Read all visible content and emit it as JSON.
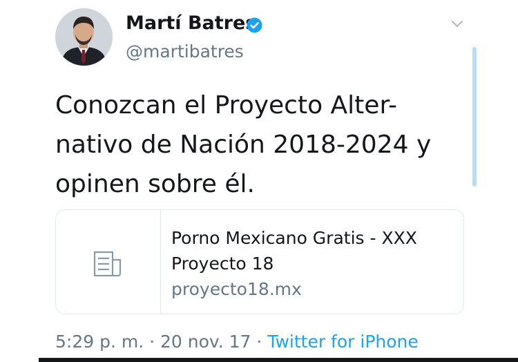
{
  "user": {
    "name": "Martí Batres",
    "handle": "@martibatres",
    "verified_icon": "verified-badge-icon",
    "avatar": "avatar"
  },
  "tweet": {
    "text_lines": [
      "Conozcan el Proyecto Alter-",
      "nativo de Nación 2018-2024 y",
      "opinen sobre él."
    ]
  },
  "card": {
    "icon": "document-icon",
    "title_lines": [
      "Porno Mexicano Gratis - XXX",
      "Proyecto 18"
    ],
    "domain": "proyecto18.mx"
  },
  "meta": {
    "time": "5:29 p. m.",
    "separator": " · ",
    "date": "20 nov. 17",
    "source": "Twitter for iPhone"
  },
  "colors": {
    "text": "#14171a",
    "secondary": "#657786",
    "link": "#1da1f2",
    "verified": "#1da1f2",
    "border": "#e1e8ed"
  },
  "icons": {
    "menu": "chevron-down-icon"
  }
}
